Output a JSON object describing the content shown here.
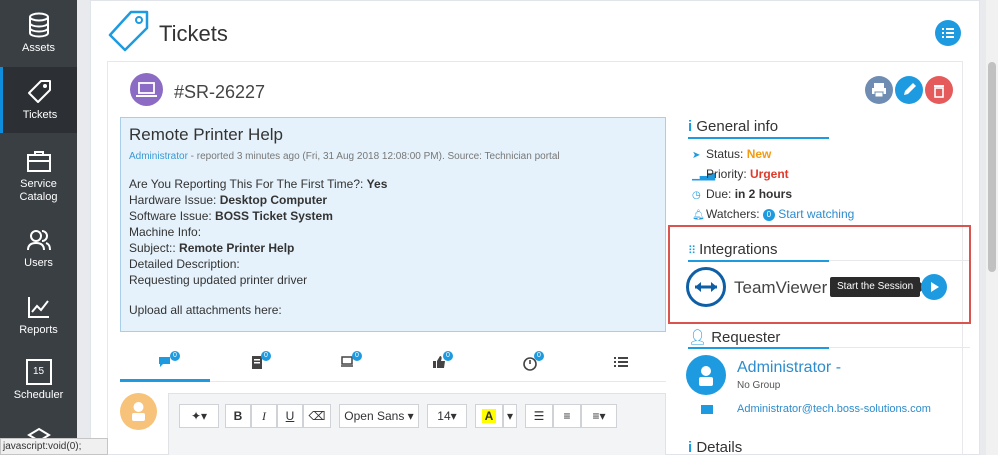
{
  "sidebar": {
    "items": [
      {
        "label": "Assets"
      },
      {
        "label": "Tickets"
      },
      {
        "label": "Service Catalog"
      },
      {
        "label": "Users"
      },
      {
        "label": "Reports"
      },
      {
        "label": "Scheduler"
      }
    ],
    "scheduler_day": "15"
  },
  "header": {
    "title": "Tickets"
  },
  "ticket": {
    "id": "#SR-26227",
    "title": "Remote Printer Help",
    "author": "Administrator",
    "meta": " - reported 3 minutes ago (Fri, 31 Aug 2018 12:08:00 PM). Source: Technician portal",
    "fields": [
      {
        "label": "Are You Reporting This For The First Time?: ",
        "value": "Yes"
      },
      {
        "label": "Hardware Issue: ",
        "value": "Desktop Computer"
      },
      {
        "label": "Software Issue: ",
        "value": "BOSS Ticket System"
      },
      {
        "label": "Machine Info:",
        "value": ""
      },
      {
        "label": "Subject:: ",
        "value": "Remote Printer Help"
      },
      {
        "label": "Detailed Description:",
        "value": ""
      },
      {
        "label": "Requesting updated printer driver",
        "value": ""
      }
    ],
    "upload_text": "Upload all attachments here:"
  },
  "tabs": [
    {
      "name": "comments",
      "badge": "0"
    },
    {
      "name": "tasks",
      "badge": "0"
    },
    {
      "name": "assets",
      "badge": "0"
    },
    {
      "name": "approvals",
      "badge": "0"
    },
    {
      "name": "timer",
      "badge": "0"
    },
    {
      "name": "list",
      "badge": ""
    }
  ],
  "editor": {
    "font": "Open Sans",
    "size": "14",
    "bold": "B",
    "italic": "I",
    "underline": "U",
    "highlight": "A"
  },
  "general_info": {
    "heading": "General info",
    "status_label": "Status: ",
    "status_value": "New",
    "priority_label": "Priority: ",
    "priority_value": "Urgent",
    "due_label": "Due: ",
    "due_value": "in 2 hours",
    "watchers_label": "Watchers: ",
    "watchers_count": "0",
    "start_watching": "Start watching"
  },
  "integrations": {
    "heading": "Integrations",
    "name": "TeamViewer",
    "tooltip": "Start the Session"
  },
  "requester": {
    "heading": "Requester",
    "name": "Administrator -",
    "group": "No Group",
    "email": "Administrator@tech.boss-solutions.com"
  },
  "details": {
    "heading": "Details"
  },
  "status_bar": "javascript:void(0);",
  "colors": {
    "accent": "#1e9be0",
    "sidebar": "#3a3f44",
    "highlight_box": "#d9534f"
  }
}
